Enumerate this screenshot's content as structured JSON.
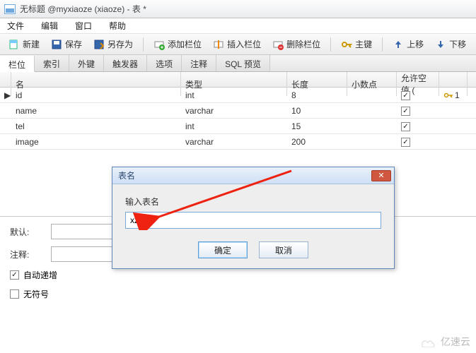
{
  "titlebar": {
    "text": "无标题 @myxiaoze (xiaoze) - 表 *"
  },
  "menu": {
    "file": "文件",
    "edit": "编辑",
    "window": "窗口",
    "help": "帮助"
  },
  "toolbar": {
    "new": "新建",
    "save": "保存",
    "saveas": "另存为",
    "addcol": "添加栏位",
    "insertcol": "插入栏位",
    "delcol": "删除栏位",
    "primary": "主键",
    "moveup": "上移",
    "movedown": "下移"
  },
  "tabs": {
    "fields": "栏位",
    "index": "索引",
    "fk": "外键",
    "trigger": "触发器",
    "options": "选项",
    "comment": "注释",
    "sqlpreview": "SQL 预览"
  },
  "headers": {
    "name": "名",
    "type": "类型",
    "len": "长度",
    "dec": "小数点",
    "null": "允许空值 ("
  },
  "rows": [
    {
      "name": "id",
      "type": "int",
      "len": "8",
      "dec": "",
      "null": true,
      "pk": "1",
      "ptr": "▶"
    },
    {
      "name": "name",
      "type": "varchar",
      "len": "10",
      "dec": "",
      "null": true,
      "pk": "",
      "ptr": ""
    },
    {
      "name": "tel",
      "type": "int",
      "len": "15",
      "dec": "",
      "null": true,
      "pk": "",
      "ptr": ""
    },
    {
      "name": "image",
      "type": "varchar",
      "len": "200",
      "dec": "",
      "null": true,
      "pk": "",
      "ptr": ""
    }
  ],
  "bottom": {
    "default_lbl": "默认:",
    "comment_lbl": "注释:",
    "autoinc": "自动递增",
    "unsigned": "无符号",
    "autoinc_checked": true,
    "unsigned_checked": false,
    "ellipsis": "..."
  },
  "dialog": {
    "title": "表名",
    "label": "输入表名",
    "value": "xz",
    "ok": "确定",
    "cancel": "取消",
    "close": "✕"
  },
  "watermark": "亿速云"
}
